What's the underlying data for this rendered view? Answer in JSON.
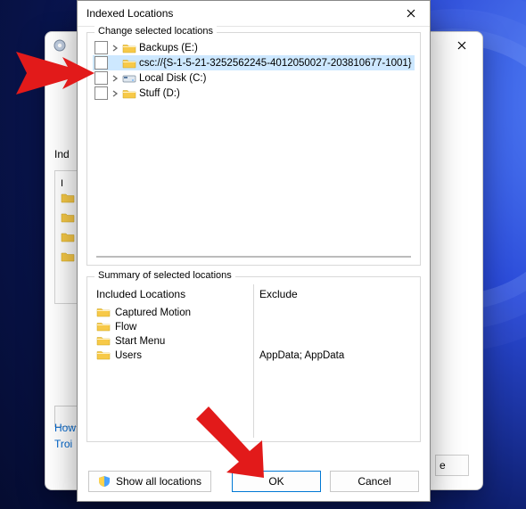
{
  "dialog": {
    "title": "Indexed Locations",
    "group_change": "Change selected locations",
    "group_summary": "Summary of selected locations",
    "tree": [
      {
        "label": "Backups (E:)",
        "icon": "folder",
        "checked": false,
        "expandable": true,
        "selected": false
      },
      {
        "label": "csc://{S-1-5-21-3252562245-4012050027-203810677-1001}",
        "icon": "folder",
        "checked": false,
        "expandable": false,
        "selected": true
      },
      {
        "label": "Local Disk (C:)",
        "icon": "disk",
        "checked": false,
        "expandable": true,
        "selected": false
      },
      {
        "label": "Stuff (D:)",
        "icon": "folder",
        "checked": false,
        "expandable": true,
        "selected": false
      }
    ],
    "included_header": "Included Locations",
    "exclude_header": "Exclude",
    "included": [
      {
        "label": "Captured Motion",
        "exclude": ""
      },
      {
        "label": "Flow",
        "exclude": ""
      },
      {
        "label": "Start Menu",
        "exclude": ""
      },
      {
        "label": "Users",
        "exclude": "AppData; AppData"
      }
    ],
    "buttons": {
      "show_all": "Show all locations",
      "ok": "OK",
      "cancel": "Cancel"
    }
  },
  "rear": {
    "left_heading": "Ind",
    "peek_box_header": "I",
    "troc": "Tro",
    "link1": "How",
    "link2": "Troi",
    "e_btn": "e"
  }
}
